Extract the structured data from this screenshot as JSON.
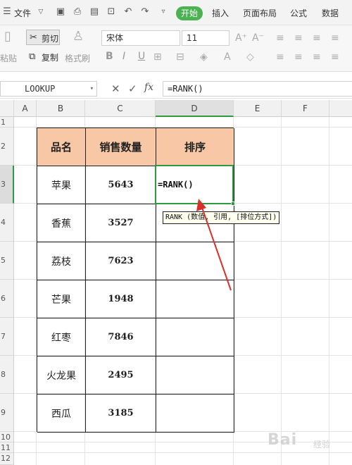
{
  "menu": {
    "file_label": "文件",
    "tabs": [
      "开始",
      "插入",
      "页面布局",
      "公式",
      "数据"
    ],
    "active_tab_index": 0
  },
  "ribbon": {
    "paste_label": "粘贴",
    "cut_label": "剪切",
    "copy_label": "复制",
    "format_painter_label": "格式刷",
    "font_name": "宋体",
    "font_size": "11",
    "bold": "B",
    "italic": "I",
    "underline": "U"
  },
  "formula_bar": {
    "name_box": "LOOKUP",
    "fx": "fx",
    "formula": "=RANK()"
  },
  "sheet": {
    "columns": [
      "A",
      "B",
      "C",
      "D",
      "E",
      "F"
    ],
    "rows": [
      "1",
      "2",
      "3",
      "4",
      "5",
      "6",
      "7",
      "8",
      "9",
      "10",
      "11",
      "12"
    ],
    "table_headers": [
      "品名",
      "销售数量",
      "排序"
    ],
    "table_rows": [
      {
        "name": "苹果",
        "qty": "5643"
      },
      {
        "name": "香蕉",
        "qty": "3527"
      },
      {
        "name": "荔枝",
        "qty": "7623"
      },
      {
        "name": "芒果",
        "qty": "1948"
      },
      {
        "name": "红枣",
        "qty": "7846"
      },
      {
        "name": "火龙果",
        "qty": "2495"
      },
      {
        "name": "西瓜",
        "qty": "3185"
      }
    ],
    "active_cell_text": "=RANK()",
    "tooltip": "RANK (数值, 引用, [排位方式])",
    "accent_color": "#2e9a3e",
    "header_fill": "#f8c8a6",
    "arrow_color": "#d9302b"
  },
  "watermark": {
    "text": "Bai",
    "sub": "经验"
  }
}
